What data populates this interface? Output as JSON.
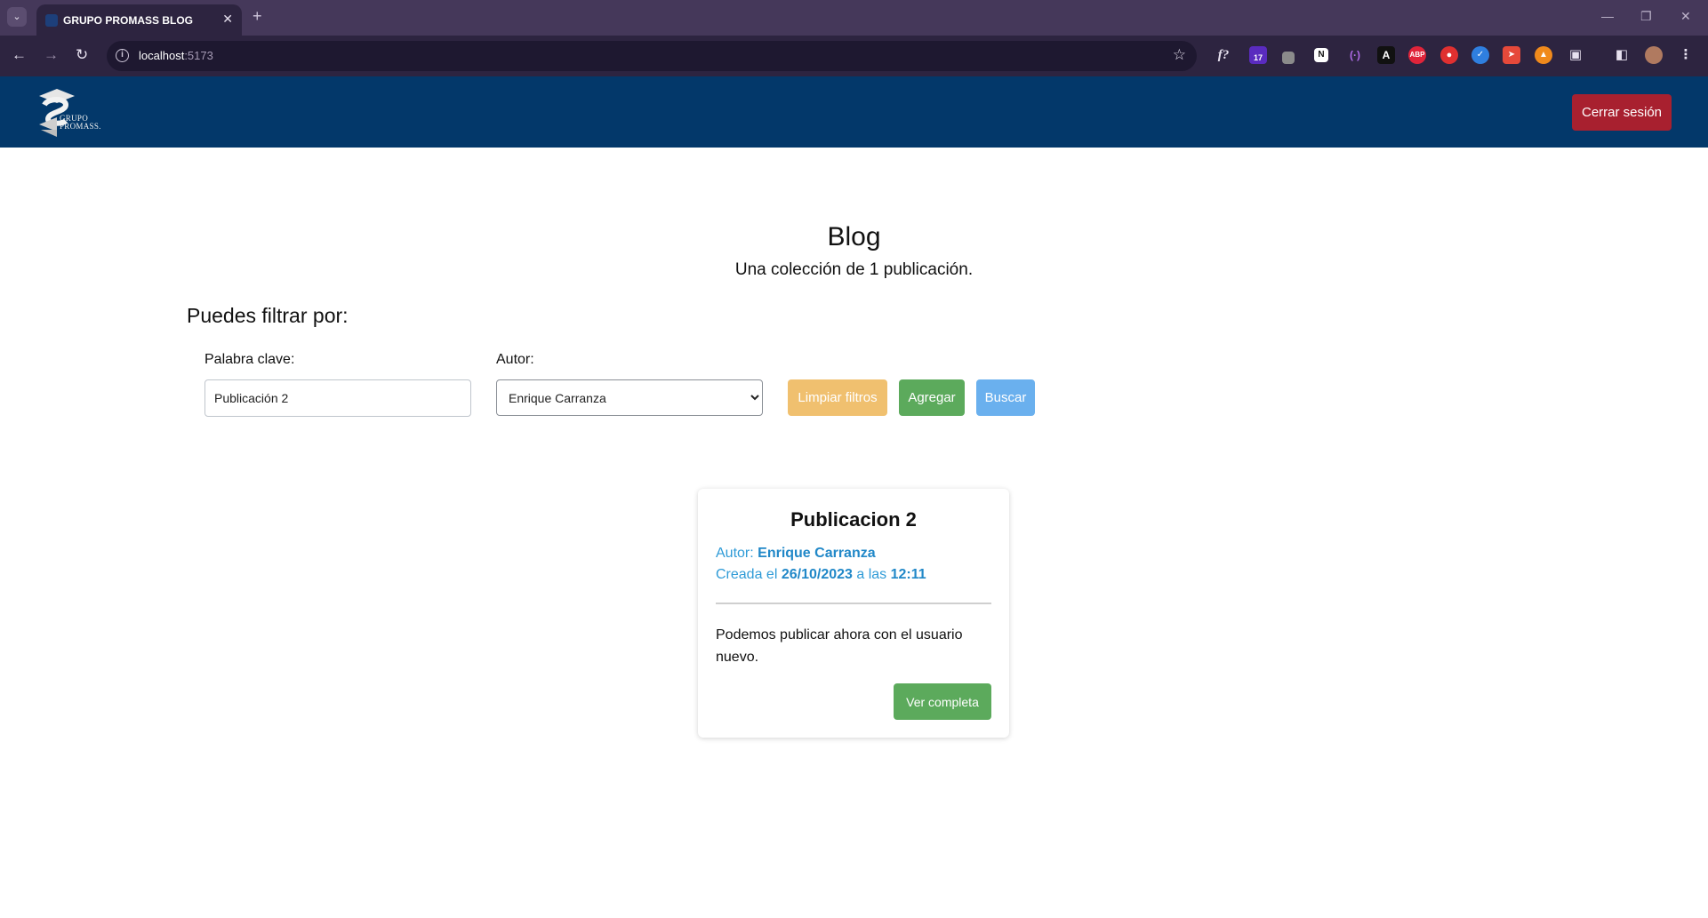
{
  "browser": {
    "tab_title": "GRUPO PROMASS BLOG",
    "url_host": "localhost",
    "url_port": ":5173",
    "extension_icons": [
      "formula-icon",
      "calendar-badge-icon",
      "puzzle-extension-icon",
      "notion-icon",
      "code-icon",
      "a-icon",
      "adblock-icon",
      "fire-icon",
      "shield-icon",
      "bolt-icon",
      "figure-icon",
      "extensions-icon",
      "sidepanel-icon",
      "profile-avatar"
    ],
    "calendar_badge": "17",
    "adblock_label": "ABP"
  },
  "header": {
    "logo_text_line1": "GRUPO",
    "logo_text_line2": "PROMASS.",
    "logout_label": "Cerrar sesión",
    "background_color": "#03386a",
    "logout_color": "#a8202f"
  },
  "main": {
    "title": "Blog",
    "subtitle": "Una colección de 1 publicación.",
    "filter_heading": "Puedes filtrar por:",
    "keyword_label": "Palabra clave:",
    "keyword_value": "Publicación 2",
    "author_label": "Autor:",
    "author_selected": "Enrique Carranza",
    "buttons": {
      "clear": "Limpiar filtros",
      "add": "Agregar",
      "search": "Buscar"
    }
  },
  "posts": [
    {
      "title": "Publicacion 2",
      "author_prefix": "Autor:",
      "author": "Enrique Carranza",
      "created_prefix": "Creada el",
      "date": "26/10/2023",
      "time_prefix": "a las",
      "time": "12:11",
      "body": "Podemos publicar ahora con el usuario nuevo.",
      "view_label": "Ver completa"
    }
  ]
}
